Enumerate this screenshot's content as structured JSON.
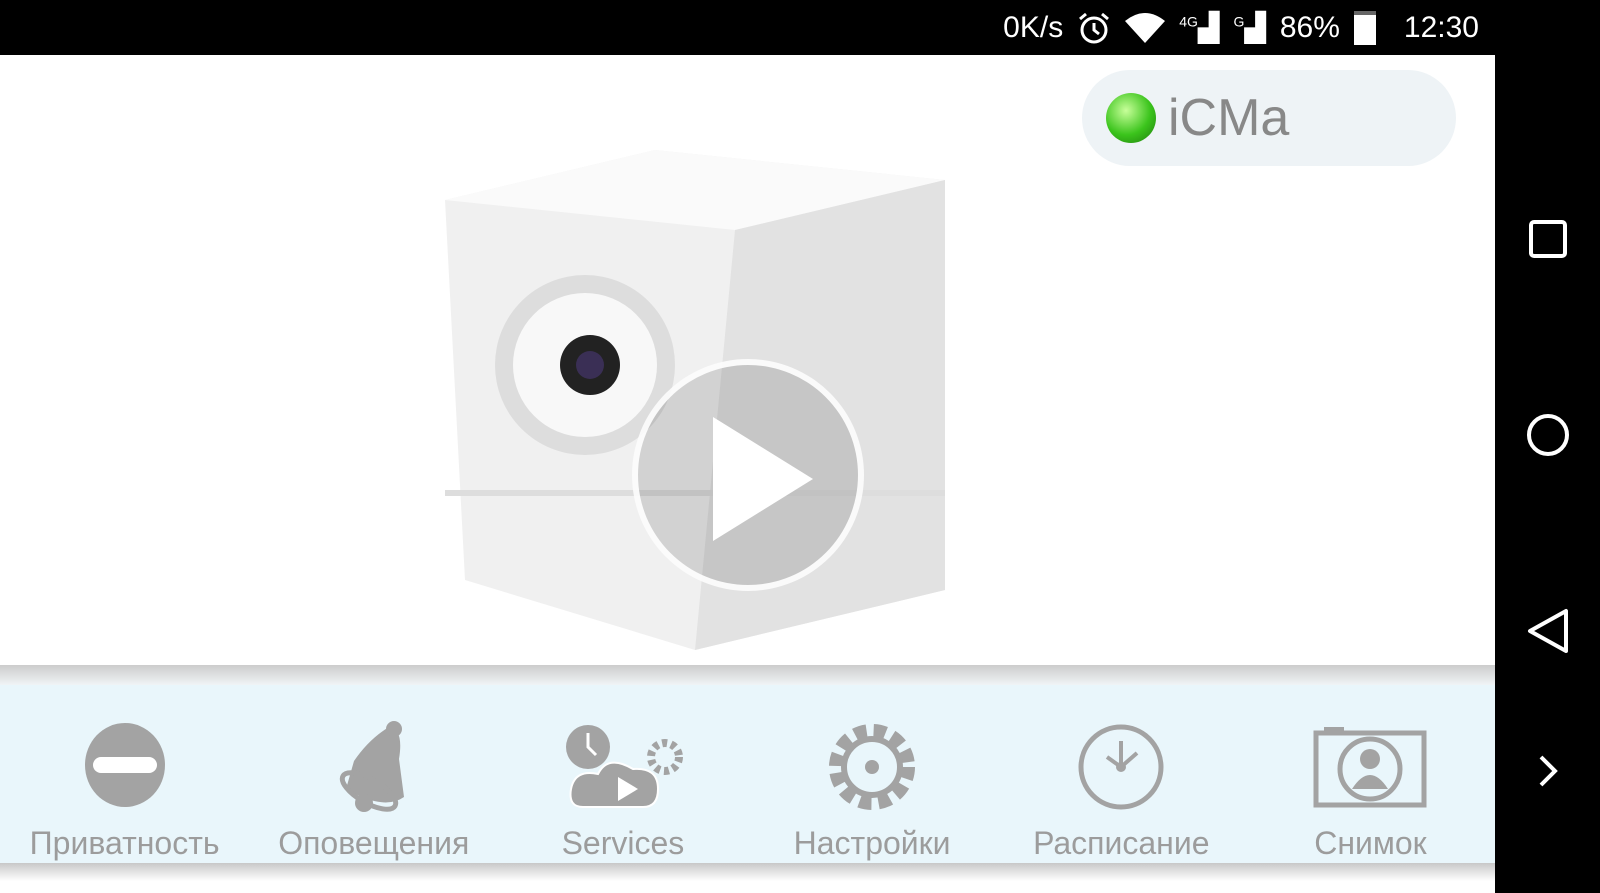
{
  "status_bar": {
    "net_speed": "0K/s",
    "alarm_icon": "alarm-icon",
    "wifi_icon": "wifi-icon",
    "signal1": "4G",
    "signal2": "G",
    "battery": "86%",
    "time": "12:30"
  },
  "camera": {
    "name": "iCMa",
    "online": true,
    "status_color": "#3bc41c",
    "play_icon": "play-icon"
  },
  "toolbar": {
    "items": [
      {
        "label": "Приватность",
        "icon": "privacy-icon"
      },
      {
        "label": "Оповещения",
        "icon": "bell-icon"
      },
      {
        "label": "Services",
        "icon": "services-icon"
      },
      {
        "label": "Настройки",
        "icon": "gear-icon"
      },
      {
        "label": "Расписание",
        "icon": "clock-icon"
      },
      {
        "label": "Снимок",
        "icon": "snapshot-icon"
      }
    ]
  },
  "nav": {
    "recent": "square-icon",
    "home": "circle-icon",
    "back": "triangle-icon",
    "more": "chevron-right-icon"
  }
}
